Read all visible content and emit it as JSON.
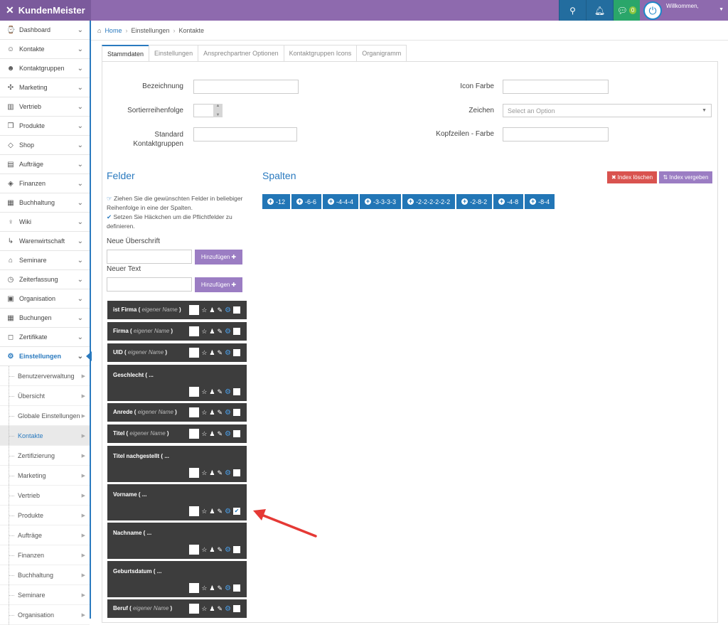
{
  "topbar": {
    "brand": "KundenMeister",
    "chat_count": "0",
    "welcome": "Willkommen,"
  },
  "sidebar": {
    "items": [
      {
        "label": "Dashboard",
        "icon": "dashboard-icon",
        "glyph": "⌚"
      },
      {
        "label": "Kontakte",
        "icon": "contacts-icon",
        "glyph": "☺"
      },
      {
        "label": "Kontaktgruppen",
        "icon": "groups-icon",
        "glyph": "☻"
      },
      {
        "label": "Marketing",
        "icon": "marketing-icon",
        "glyph": "✣"
      },
      {
        "label": "Vertrieb",
        "icon": "sales-chart-icon",
        "glyph": "▥"
      },
      {
        "label": "Produkte",
        "icon": "box-icon",
        "glyph": "❒"
      },
      {
        "label": "Shop",
        "icon": "tag-icon",
        "glyph": "◇"
      },
      {
        "label": "Aufträge",
        "icon": "orders-icon",
        "glyph": "▤"
      },
      {
        "label": "Finanzen",
        "icon": "money-icon",
        "glyph": "◈"
      },
      {
        "label": "Buchhaltung",
        "icon": "calculator-icon",
        "glyph": "▦"
      },
      {
        "label": "Wiki",
        "icon": "lightbulb-icon",
        "glyph": "♀"
      },
      {
        "label": "Warenwirtschaft",
        "icon": "dolly-icon",
        "glyph": "↳"
      },
      {
        "label": "Seminare",
        "icon": "graduation-cap-icon",
        "glyph": "⌂"
      },
      {
        "label": "Zeiterfassung",
        "icon": "clock-icon",
        "glyph": "◷"
      },
      {
        "label": "Organisation",
        "icon": "clipboard-icon",
        "glyph": "▣"
      },
      {
        "label": "Buchungen",
        "icon": "calendar-icon",
        "glyph": "▦"
      },
      {
        "label": "Zertifikate",
        "icon": "bookmark-icon",
        "glyph": "◻"
      },
      {
        "label": "Einstellungen",
        "icon": "gear-icon",
        "glyph": "⚙"
      }
    ],
    "subitems": [
      "Benutzerverwaltung",
      "Übersicht",
      "Globale Einstellungen",
      "Kontakte",
      "Zertifizierung",
      "Marketing",
      "Vertrieb",
      "Produkte",
      "Aufträge",
      "Finanzen",
      "Buchhaltung",
      "Seminare",
      "Organisation"
    ]
  },
  "breadcrumb": {
    "home": "Home",
    "level1": "Einstellungen",
    "level2": "Kontakte"
  },
  "tabs": [
    "Stammdaten",
    "Einstellungen",
    "Ansprechpartner Optionen",
    "Kontaktgruppen Icons",
    "Organigramm"
  ],
  "form": {
    "bezeichnung": "Bezeichnung",
    "sortierreihenfolge": "Sortierreihenfolge",
    "standard_line1": "Standard",
    "standard_line2": "Kontaktgruppen",
    "icon_farbe": "Icon Farbe",
    "zeichen": "Zeichen",
    "zeichen_placeholder": "Select an Option",
    "kopfzeilen": "Kopfzeilen - Farbe"
  },
  "felder": {
    "title": "Felder",
    "hint1": "Ziehen Sie die gewünschten Felder in beliebiger Reihenfolge in eine der Spalten.",
    "hint2": "Setzen Sie Häckchen um die Pflichtfelder zu definieren.",
    "neue_ueberschrift": "Neue Überschrift",
    "neuer_text": "Neuer Text",
    "add_label": "Hinzufügen"
  },
  "spalten": {
    "title": "Spalten",
    "index_loeschen": "Index löschen",
    "index_vergeben": "Index vergeben",
    "layouts": [
      "-12",
      "-6-6",
      "-4-4-4",
      "-3-3-3-3",
      "-2-2-2-2-2-2",
      "-2-8-2",
      "-4-8",
      "-8-4"
    ]
  },
  "fields": [
    {
      "name": "ist Firma (",
      "custom": "eigener Name",
      "close": ")",
      "checked": false
    },
    {
      "name": "Firma (",
      "custom": "eigener Name",
      "close": ")",
      "checked": false
    },
    {
      "name": "UID (",
      "custom": "eigener Name",
      "close": ")",
      "checked": false
    },
    {
      "name": "Geschlecht ( ...",
      "custom": "",
      "close": "",
      "checked": false
    },
    {
      "name": "Anrede (",
      "custom": "eigener Name",
      "close": ")",
      "checked": false
    },
    {
      "name": "Titel (",
      "custom": "eigener Name",
      "close": ")",
      "checked": false
    },
    {
      "name": "Titel nachgestellt ( ...",
      "custom": "",
      "close": "",
      "checked": false
    },
    {
      "name": "Vorname ( ...",
      "custom": "",
      "close": "",
      "checked": true
    },
    {
      "name": "Nachname ( ...",
      "custom": "",
      "close": "",
      "checked": false
    },
    {
      "name": "Geburtsdatum ( ...",
      "custom": "",
      "close": "",
      "checked": false
    },
    {
      "name": "Beruf (",
      "custom": "eigener Name",
      "close": ")",
      "checked": false
    }
  ],
  "colors": {
    "brand_purple": "#8e6aae",
    "primary_blue": "#2276b6",
    "danger_red": "#d9534f",
    "annotation_red": "#e53935"
  }
}
